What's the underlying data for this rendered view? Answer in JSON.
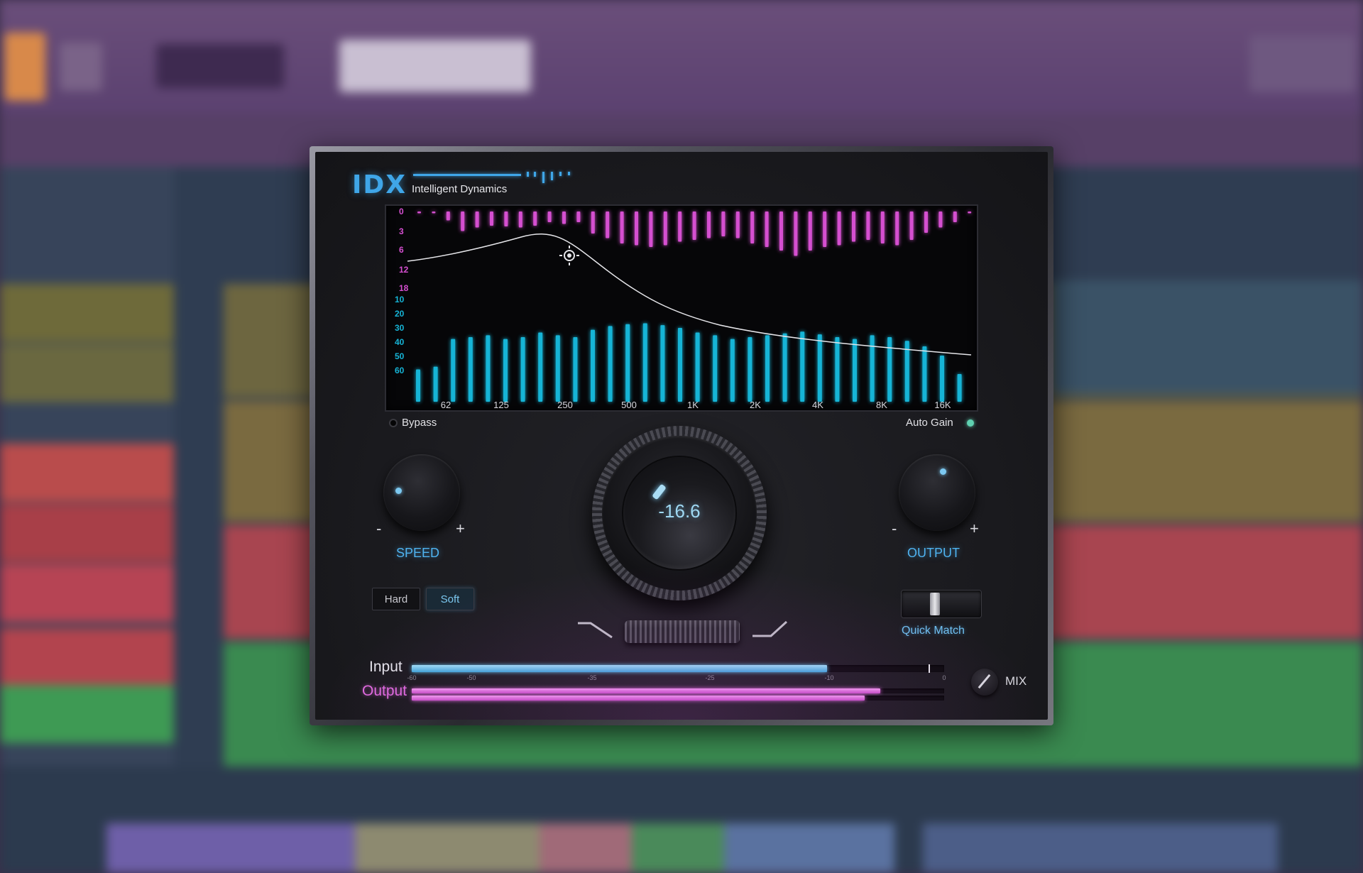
{
  "plugin": {
    "logo": "IDX",
    "subtitle": "Intelligent Dynamics",
    "bypass_label": "Bypass",
    "auto_gain_label": "Auto Gain",
    "speed_label": "SPEED",
    "output_label": "OUTPUT",
    "plus": "+",
    "minus": "-",
    "main_value": "-16.6",
    "hard_label": "Hard",
    "soft_label": "Soft",
    "selected_mode": "Soft",
    "quick_match_label": "Quick Match",
    "mix_label": "MIX",
    "colors": {
      "accent_blue": "#4fb3f0",
      "cyan_bars": "#16b4d6",
      "magenta_bars": "#d54fd0",
      "output_pink": "#e06bdf",
      "led_green": "#5fd0b0"
    }
  },
  "analyzer": {
    "db_labels_top": [
      "0",
      "3",
      "6",
      "12",
      "18"
    ],
    "db_labels_bottom": [
      "10",
      "20",
      "30",
      "40",
      "50",
      "60"
    ],
    "freq_labels": [
      "62",
      "125",
      "250",
      "500",
      "1K",
      "2K",
      "4K",
      "8K",
      "16K"
    ],
    "gain_reduction": [
      0.05,
      0.05,
      0.25,
      0.55,
      0.45,
      0.4,
      0.42,
      0.45,
      0.4,
      0.3,
      0.35,
      0.3,
      0.62,
      0.75,
      0.9,
      0.95,
      1.0,
      0.95,
      0.85,
      0.8,
      0.75,
      0.7,
      0.75,
      0.9,
      1.0,
      1.1,
      1.25,
      1.1,
      1.0,
      0.95,
      0.85,
      0.8,
      0.9,
      0.95,
      0.8,
      0.6,
      0.45,
      0.3,
      0.05
    ],
    "spectrum": [
      0.35,
      0.38,
      0.68,
      0.7,
      0.72,
      0.68,
      0.7,
      0.75,
      0.72,
      0.7,
      0.78,
      0.82,
      0.84,
      0.85,
      0.83,
      0.8,
      0.75,
      0.72,
      0.68,
      0.7,
      0.72,
      0.74,
      0.76,
      0.73,
      0.7,
      0.68,
      0.72,
      0.7,
      0.66,
      0.6,
      0.5,
      0.3
    ]
  },
  "meters": {
    "input_label": "Input",
    "output_label": "Output",
    "scale": [
      "-60",
      "-50",
      "-35",
      "-25",
      "-10",
      "0"
    ],
    "input_level": 0.78,
    "input_peak": 0.97,
    "output_level_top": 0.88,
    "output_level_bottom": 0.85
  }
}
